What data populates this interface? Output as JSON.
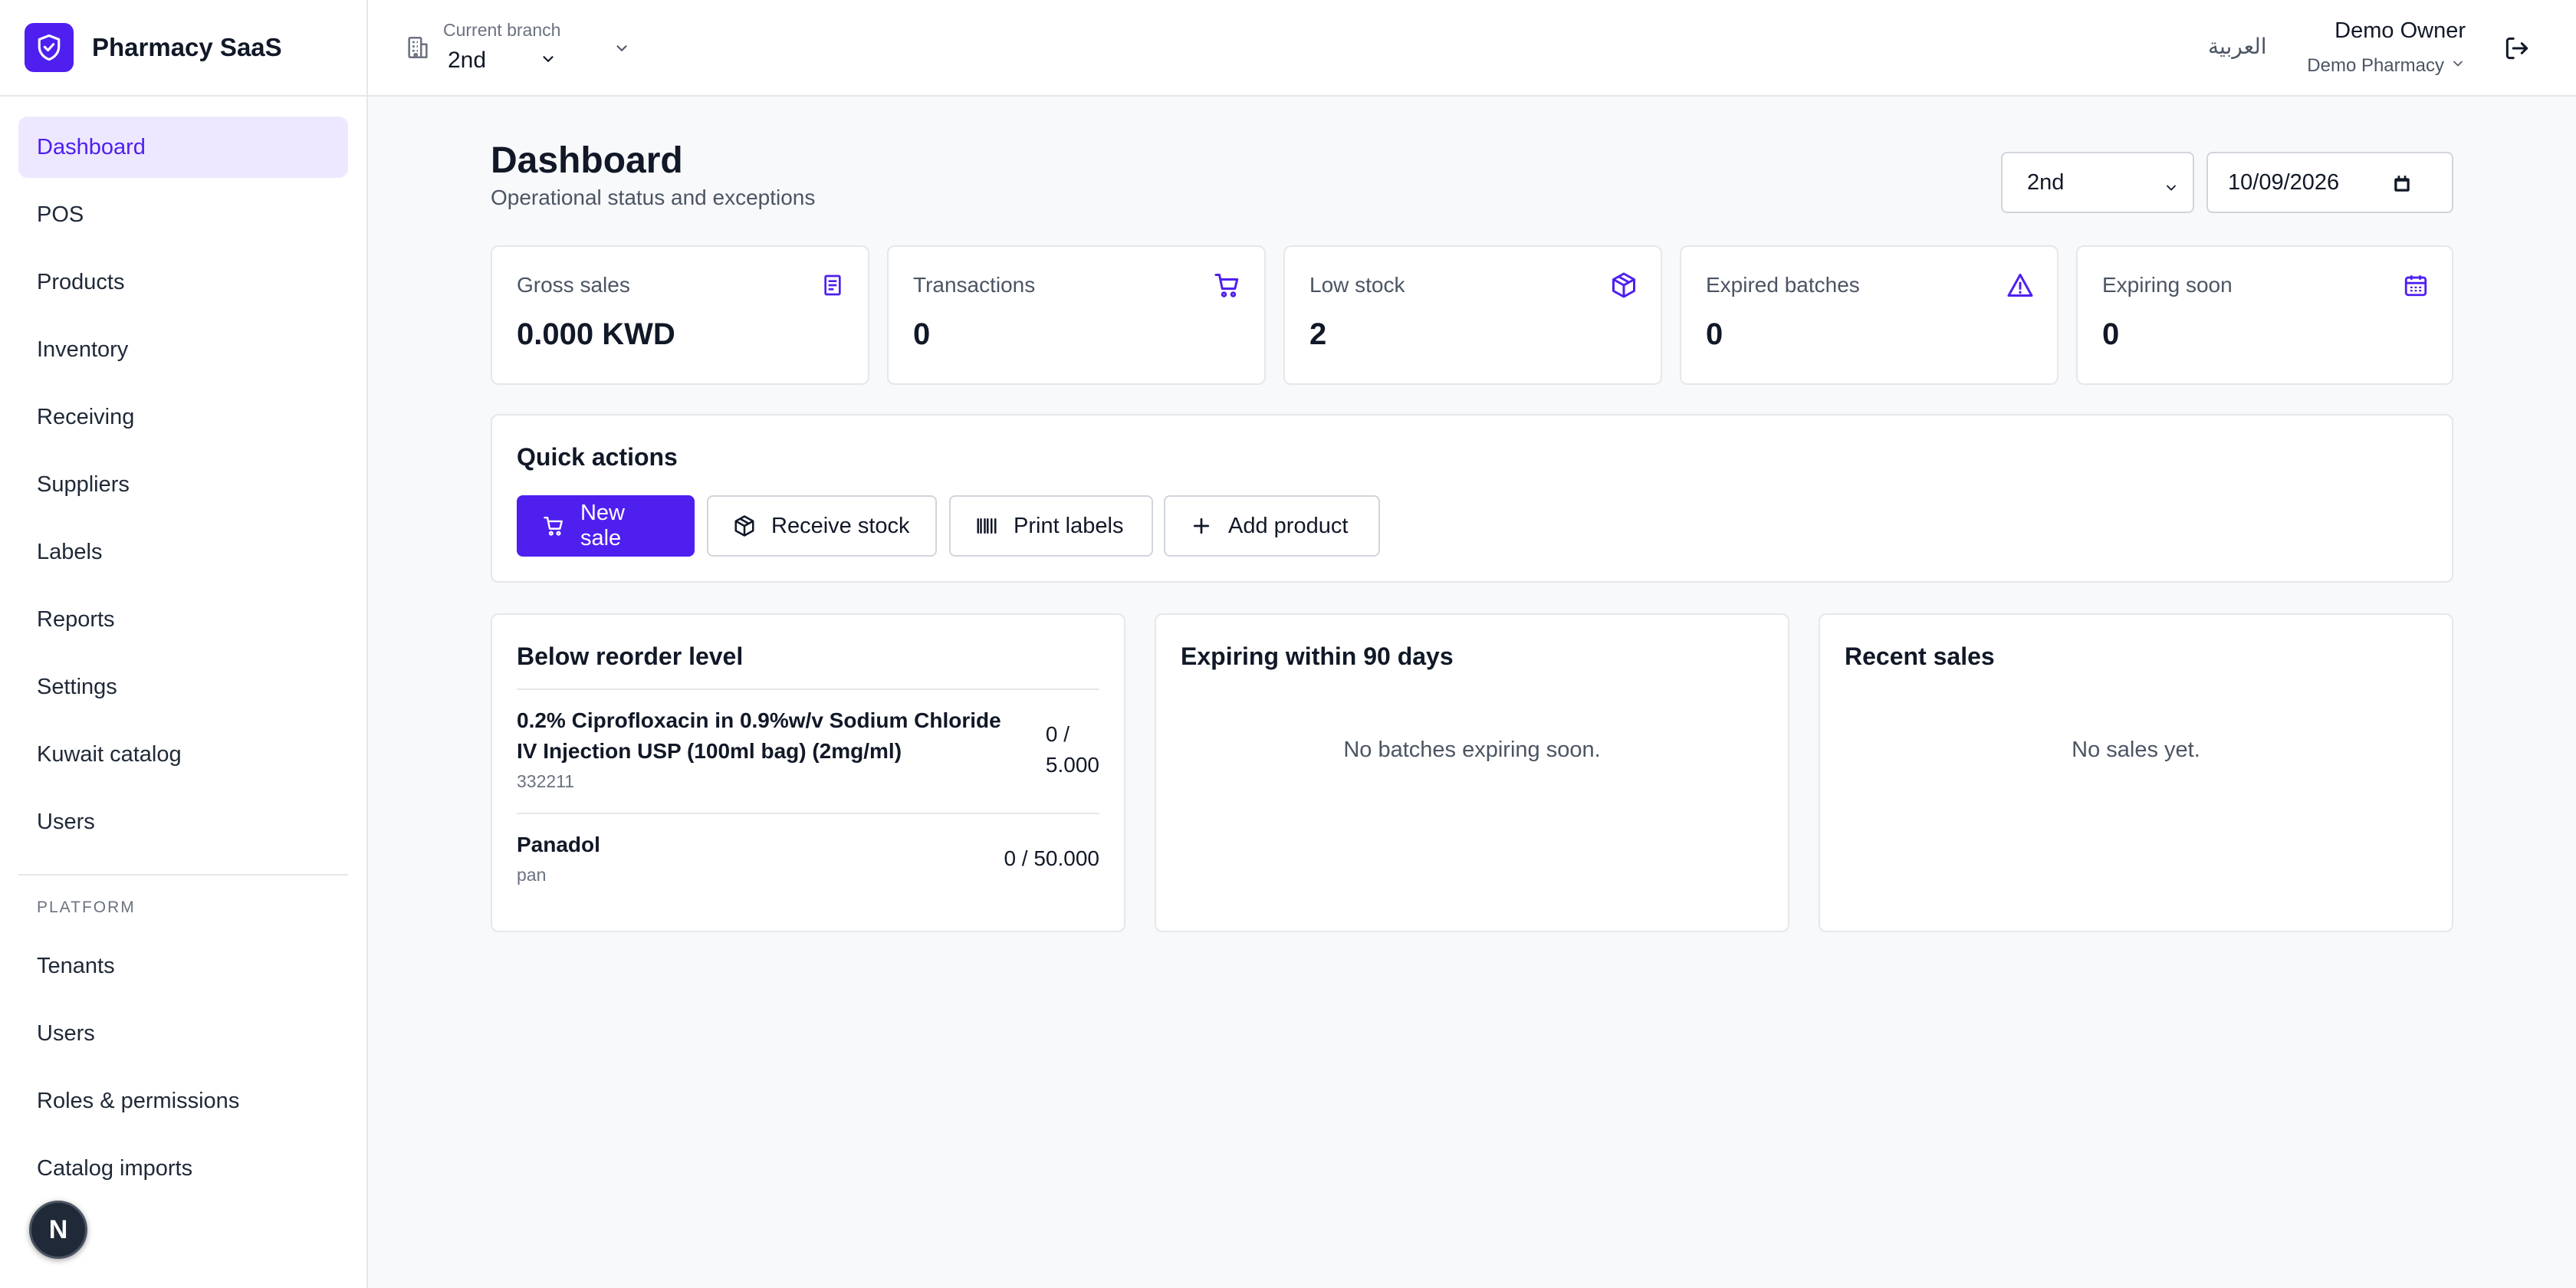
{
  "app": {
    "name": "Pharmacy SaaS",
    "accent": "#4f1ff0"
  },
  "sidebar": {
    "items": [
      {
        "label": "Dashboard",
        "active": true
      },
      {
        "label": "POS"
      },
      {
        "label": "Products"
      },
      {
        "label": "Inventory"
      },
      {
        "label": "Receiving"
      },
      {
        "label": "Suppliers"
      },
      {
        "label": "Labels"
      },
      {
        "label": "Reports"
      },
      {
        "label": "Settings"
      },
      {
        "label": "Kuwait catalog"
      },
      {
        "label": "Users"
      }
    ],
    "platform_section": "PLATFORM",
    "platform_items": [
      {
        "label": "Tenants"
      },
      {
        "label": "Users"
      },
      {
        "label": "Roles & permissions"
      },
      {
        "label": "Catalog imports"
      }
    ],
    "dev_badge": "N"
  },
  "header": {
    "branch_label": "Current branch",
    "branch_value": "2nd",
    "language": "العربية",
    "user_name": "Demo Owner",
    "org_name": "Demo Pharmacy"
  },
  "page": {
    "title": "Dashboard",
    "subtitle": "Operational status and exceptions",
    "filter_branch": "2nd",
    "filter_date": "10/09/2026"
  },
  "stats": [
    {
      "label": "Gross sales",
      "value": "0.000 KWD",
      "icon": "receipt-icon"
    },
    {
      "label": "Transactions",
      "value": "0",
      "icon": "cart-icon"
    },
    {
      "label": "Low stock",
      "value": "2",
      "icon": "package-icon"
    },
    {
      "label": "Expired batches",
      "value": "0",
      "icon": "warning-icon"
    },
    {
      "label": "Expiring soon",
      "value": "0",
      "icon": "calendar-icon"
    }
  ],
  "quick_actions": {
    "title": "Quick actions",
    "buttons": [
      {
        "label": "New sale",
        "icon": "cart-icon"
      },
      {
        "label": "Receive stock",
        "icon": "package-icon"
      },
      {
        "label": "Print labels",
        "icon": "barcode-icon"
      },
      {
        "label": "Add product",
        "icon": "plus-icon"
      }
    ]
  },
  "reorder": {
    "title": "Below reorder level",
    "rows": [
      {
        "name_line1": "0.2% Ciprofloxacin in 0.9%w/v Sodium Chloride",
        "name_line2": "IV Injection USP (100ml bag) (2mg/ml)",
        "code": "332211",
        "qty_line1": "0 /",
        "qty_line2": "5.000"
      },
      {
        "name_line1": "Panadol",
        "code": "pan",
        "qty_line1": "0 / 50.000"
      }
    ]
  },
  "expiring": {
    "title": "Expiring within 90 days",
    "empty": "No batches expiring soon."
  },
  "recent_sales": {
    "title": "Recent sales",
    "empty": "No sales yet."
  }
}
